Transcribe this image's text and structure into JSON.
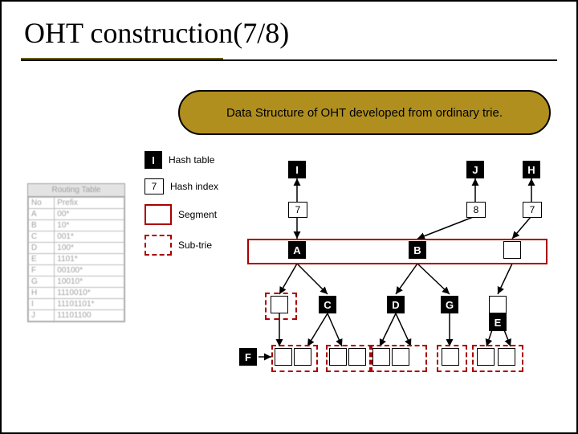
{
  "title": "OHT construction(7/8)",
  "caption": "Data Structure of OHT developed from ordinary trie.",
  "legend": {
    "hash_table": {
      "symbol": "I",
      "label": "Hash table"
    },
    "hash_index": {
      "symbol": "7",
      "label": "Hash index"
    },
    "segment": {
      "label": "Segment"
    },
    "sub_trie": {
      "label": "Sub-trie"
    }
  },
  "routing_table": {
    "title": "Routing Table",
    "headers": [
      "No",
      "Prefix"
    ],
    "rows": [
      [
        "A",
        "00*"
      ],
      [
        "B",
        "10*"
      ],
      [
        "C",
        "001*"
      ],
      [
        "D",
        "100*"
      ],
      [
        "E",
        "1101*"
      ],
      [
        "F",
        "00100*"
      ],
      [
        "G",
        "10010*"
      ],
      [
        "H",
        "1110010*"
      ],
      [
        "I",
        "11101101*"
      ],
      [
        "J",
        "11101100"
      ]
    ]
  },
  "diagram": {
    "hash_nodes": {
      "I": "I",
      "J": "J",
      "H": "H"
    },
    "idx_nodes": {
      "seven_a": "7",
      "eight": "8",
      "seven_b": "7"
    },
    "labels": {
      "A": "A",
      "B": "B",
      "C": "C",
      "D": "D",
      "E": "E",
      "F": "F",
      "G": "G"
    }
  }
}
